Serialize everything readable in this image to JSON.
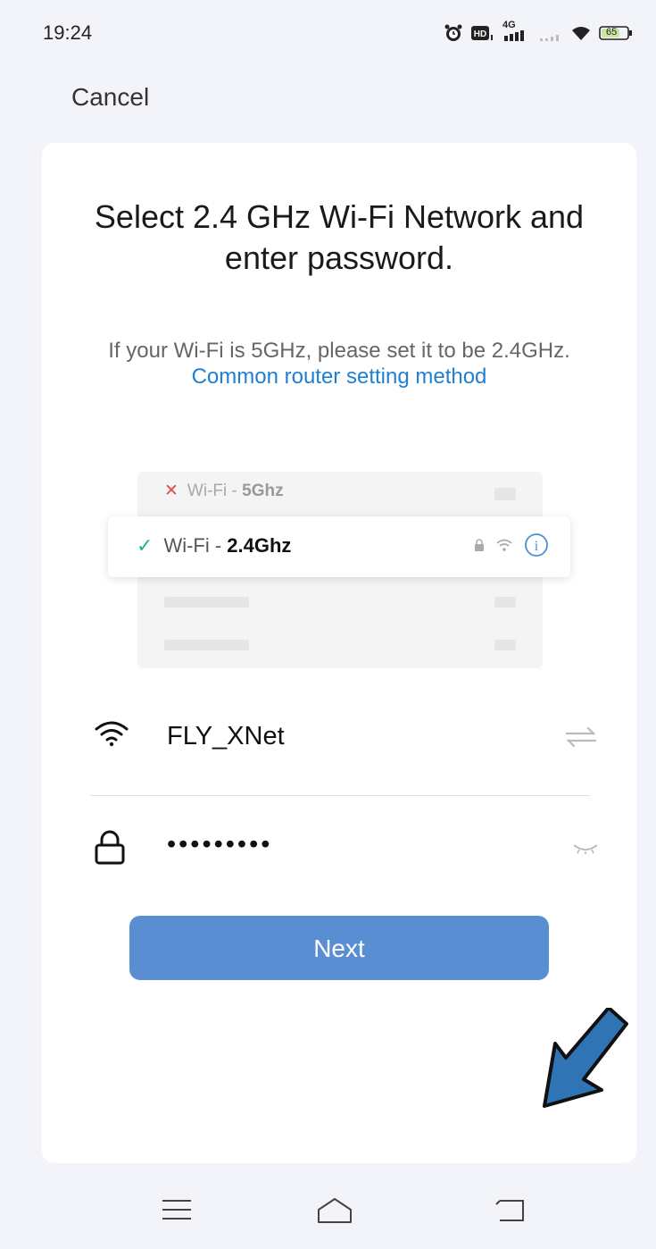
{
  "status_bar": {
    "time": "19:24",
    "network_label": "4G",
    "battery": "65",
    "icons": [
      "alarm-icon",
      "hd-icon",
      "cellular-signal-icon",
      "wifi-icon",
      "battery-icon"
    ]
  },
  "header": {
    "cancel_label": "Cancel"
  },
  "card": {
    "title": "Select 2.4 GHz Wi-Fi Network and enter password.",
    "subtitle_text": "If your Wi-Fi is 5GHz, please set it to be 2.4GHz.",
    "subtitle_link": "Common router setting method"
  },
  "illustration": {
    "row_5ghz_prefix": "Wi-Fi - ",
    "row_5ghz_band": "5Ghz",
    "row_24ghz_prefix": "Wi-Fi - ",
    "row_24ghz_band": "2.4Ghz"
  },
  "form": {
    "ssid_value": "FLY_XNet",
    "password_masked": "•••••••••"
  },
  "actions": {
    "next_label": "Next"
  },
  "colors": {
    "primary_button": "#5a8ed2",
    "link": "#1f7fd1",
    "check_green": "#2bb673",
    "x_red": "#e24b4b",
    "arrow_fill": "#2f74b5"
  }
}
